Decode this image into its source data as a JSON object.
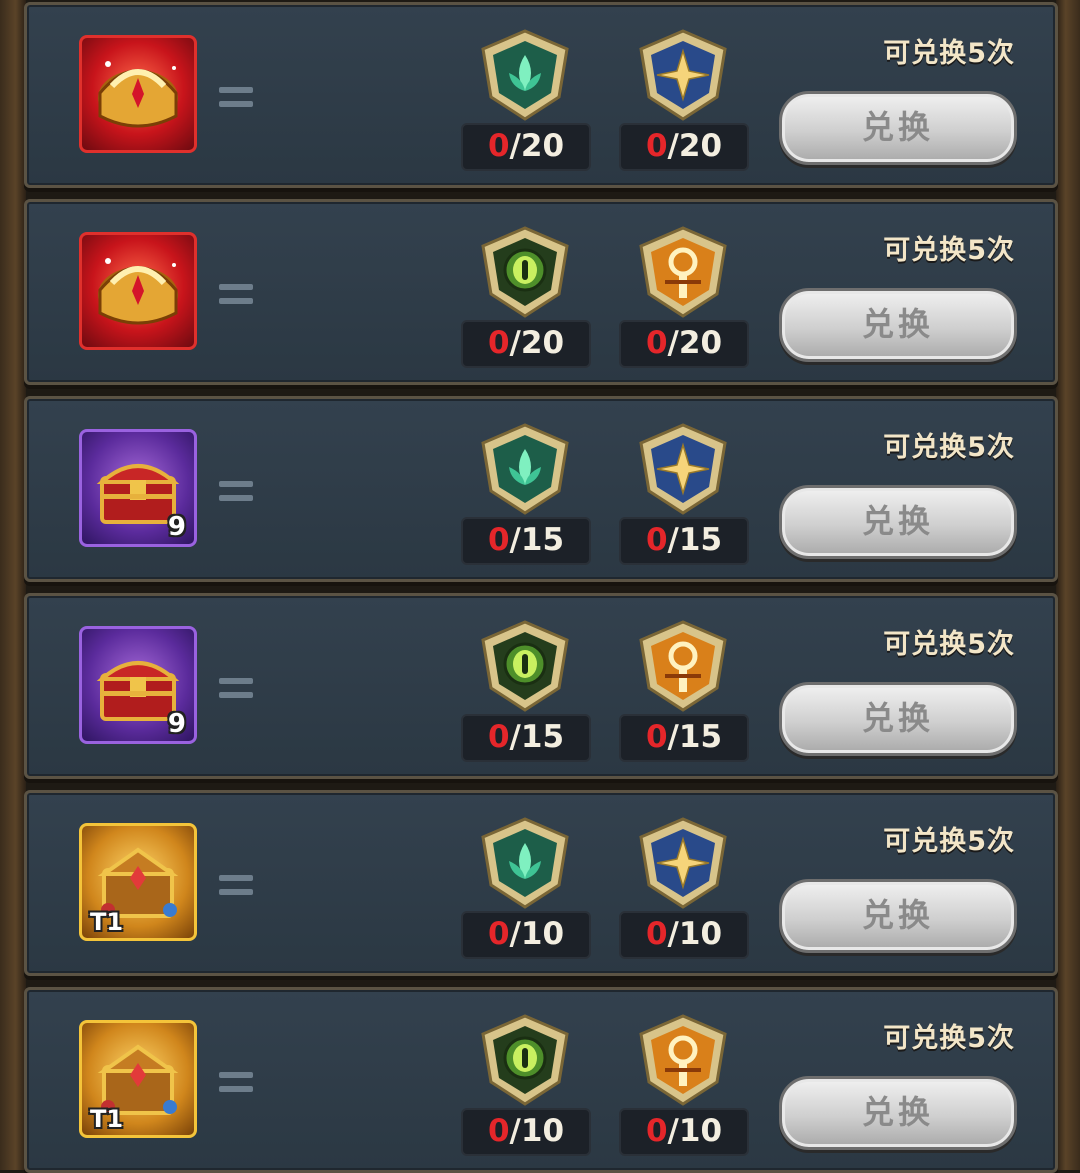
{
  "rows": [
    {
      "item_icon": "red-treasure-chest-icon",
      "item_badge": "",
      "mat1_icon": "green-lotus-shield-icon",
      "mat1_current": "0",
      "mat1_total": "/20",
      "mat2_icon": "blue-star-shield-icon",
      "mat2_current": "0",
      "mat2_total": "/20",
      "limit_text": "可兑换5次",
      "button_label": "兑换"
    },
    {
      "item_icon": "red-treasure-chest-icon",
      "item_badge": "",
      "mat1_icon": "green-eye-shield-icon",
      "mat1_current": "0",
      "mat1_total": "/20",
      "mat2_icon": "orange-sword-shield-icon",
      "mat2_current": "0",
      "mat2_total": "/20",
      "limit_text": "可兑换5次",
      "button_label": "兑换"
    },
    {
      "item_icon": "purple-treasure-chest-icon",
      "item_badge": "9",
      "mat1_icon": "green-lotus-shield-icon",
      "mat1_current": "0",
      "mat1_total": "/15",
      "mat2_icon": "blue-star-shield-icon",
      "mat2_current": "0",
      "mat2_total": "/15",
      "limit_text": "可兑换5次",
      "button_label": "兑换"
    },
    {
      "item_icon": "purple-treasure-chest-icon",
      "item_badge": "9",
      "mat1_icon": "green-eye-shield-icon",
      "mat1_current": "0",
      "mat1_total": "/15",
      "mat2_icon": "orange-sword-shield-icon",
      "mat2_current": "0",
      "mat2_total": "/15",
      "limit_text": "可兑换5次",
      "button_label": "兑换"
    },
    {
      "item_icon": "gold-treasure-chest-icon",
      "item_badge": "T1",
      "mat1_icon": "green-lotus-shield-icon",
      "mat1_current": "0",
      "mat1_total": "/10",
      "mat2_icon": "blue-star-shield-icon",
      "mat2_current": "0",
      "mat2_total": "/10",
      "limit_text": "可兑换5次",
      "button_label": "兑换"
    },
    {
      "item_icon": "gold-treasure-chest-icon",
      "item_badge": "T1",
      "mat1_icon": "green-eye-shield-icon",
      "mat1_current": "0",
      "mat1_total": "/10",
      "mat2_icon": "orange-sword-shield-icon",
      "mat2_current": "0",
      "mat2_total": "/10",
      "limit_text": "可兑换5次",
      "button_label": "兑换"
    }
  ],
  "colors": {
    "count_current": "#e5262a",
    "button_text": "#8a8a8a",
    "limit_text": "#f3e6c8"
  }
}
